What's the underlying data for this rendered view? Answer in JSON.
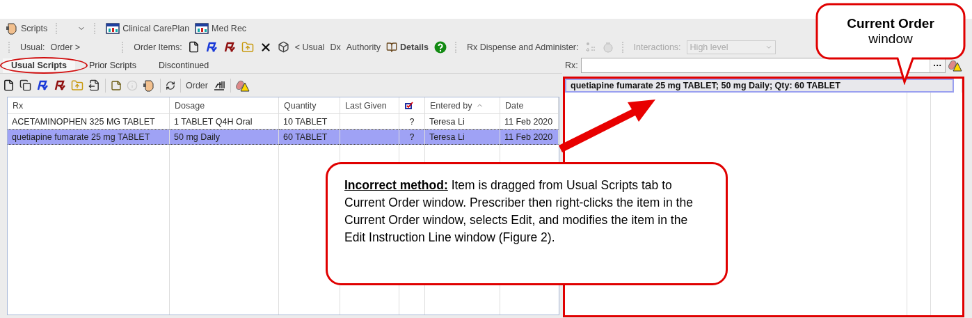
{
  "top_toolbar": {
    "items": [
      {
        "kind": "face",
        "label": "Scripts"
      },
      {
        "kind": "dropdown"
      },
      {
        "kind": "window",
        "label": "Clinical CarePlan"
      },
      {
        "kind": "window",
        "label": "Med Rec"
      }
    ]
  },
  "order_toolbar": {
    "usual_label": "Usual:",
    "usual_link": "Order >",
    "order_items_label": "Order Items:",
    "links": [
      "< Usual",
      "Dx",
      "Authority"
    ],
    "details": "Details",
    "dispense_label": "Rx Dispense and Administer:",
    "interactions_label": "Interactions:",
    "interactions_value": "High level",
    "interactions_disabled": true
  },
  "tabs": [
    {
      "label": "Usual Scripts",
      "selected": true
    },
    {
      "label": "Prior Scripts",
      "selected": false
    },
    {
      "label": "Discontinued",
      "selected": false
    }
  ],
  "list_toolbar": {
    "order_label": "Order"
  },
  "table": {
    "columns": [
      {
        "kind": "text",
        "label": "Rx"
      },
      {
        "kind": "text",
        "label": "Dosage"
      },
      {
        "kind": "text",
        "label": "Quantity"
      },
      {
        "kind": "text",
        "label": "Last Given"
      },
      {
        "kind": "flag"
      },
      {
        "kind": "text",
        "label": "Entered by",
        "sort_ascending": true
      },
      {
        "kind": "text",
        "label": "Date"
      }
    ],
    "rows": [
      {
        "selected": false,
        "cells": [
          "ACETAMINOPHEN 325 MG TABLET",
          "1 TABLET Q4H Oral",
          "10 TABLET",
          "",
          "?",
          "Teresa Li",
          "11 Feb 2020"
        ]
      },
      {
        "selected": true,
        "cells": [
          "quetiapine fumarate 25 mg TABLET",
          "50 mg Daily",
          "60 TABLET",
          "",
          "?",
          "Teresa Li",
          "11 Feb 2020"
        ]
      }
    ]
  },
  "rx_field": {
    "label": "Rx:",
    "button": "···"
  },
  "current_order": {
    "items": [
      {
        "text": "quetiapine fumarate 25 mg TABLET; 50 mg Daily; Qty: 60 TABLET",
        "selected": true
      }
    ]
  },
  "annotations": [
    {
      "kind": "bubble",
      "title": "Current Order",
      "text": "window"
    },
    {
      "kind": "box",
      "text": "**Incorrect method:** Item is dragged from Usual Scripts tab to Current Order window. Prescriber then right-clicks the item in the Current Order window, selects Edit, and modifies the item in the Edit Instruction Line window  (Figure 2)."
    }
  ]
}
